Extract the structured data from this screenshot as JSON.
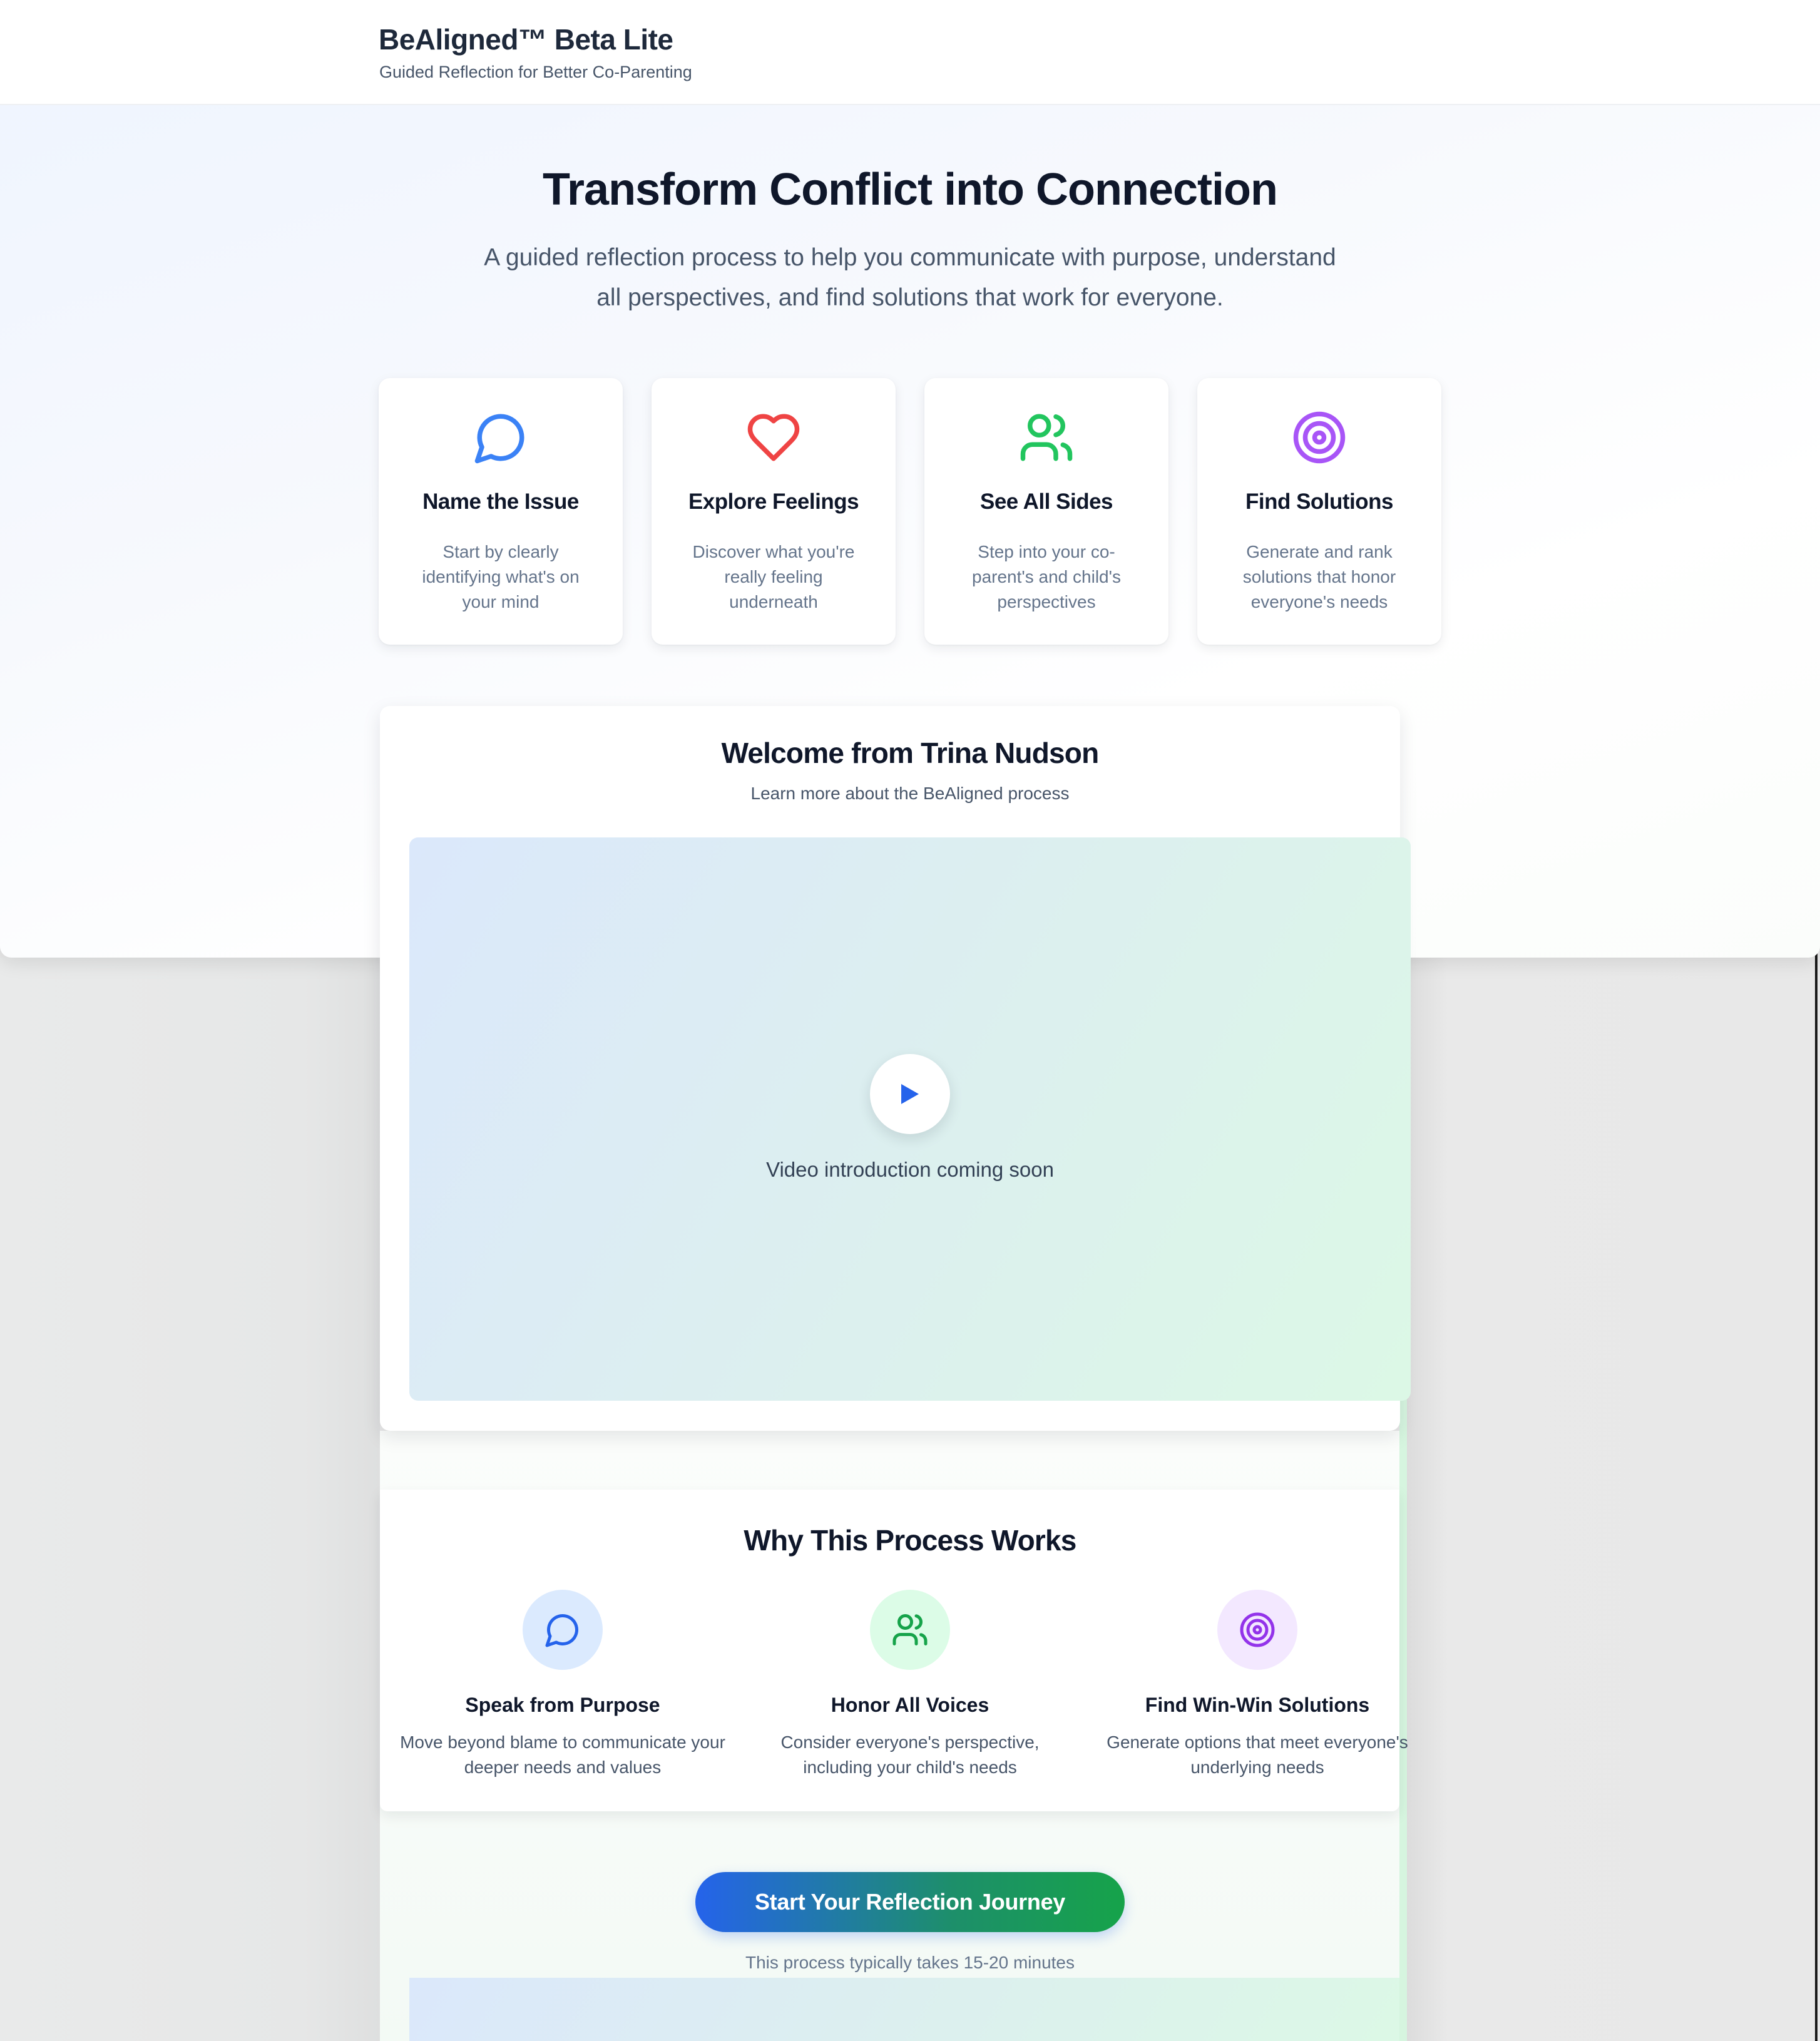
{
  "header": {
    "brand_title": "BeAligned™ Beta Lite",
    "brand_subtitle": "Guided Reflection for Better Co-Parenting"
  },
  "hero": {
    "title": "Transform Conflict into Connection",
    "subtitle": "A guided reflection process to help you communicate with purpose, understand all perspectives, and find solutions that work for everyone."
  },
  "steps": [
    {
      "icon": "chat-bubble-icon",
      "color": "#3b82f6",
      "title": "Name the Issue",
      "description": "Start by clearly identifying what's on your mind"
    },
    {
      "icon": "heart-icon",
      "color": "#ef4444",
      "title": "Explore Feelings",
      "description": "Discover what you're really feeling underneath"
    },
    {
      "icon": "users-icon",
      "color": "#22c55e",
      "title": "See All Sides",
      "description": "Step into your co-parent's and child's perspectives"
    },
    {
      "icon": "target-icon",
      "color": "#a855f7",
      "title": "Find Solutions",
      "description": "Generate and rank solutions that honor everyone's needs"
    }
  ],
  "welcome": {
    "title": "Welcome from Trina Nudson",
    "subtitle": "Learn more about the BeAligned process",
    "video_caption": "Video introduction coming soon"
  },
  "why": {
    "title": "Why This Process Works",
    "items": [
      {
        "icon": "chat-bubble-icon",
        "color": "#2563eb",
        "bg": "#dbeafe",
        "title": "Speak from Purpose",
        "description": "Move beyond blame to communicate your deeper needs and values"
      },
      {
        "icon": "users-icon",
        "color": "#16a34a",
        "bg": "#dcfce7",
        "title": "Honor All Voices",
        "description": "Consider everyone's perspective, including your child's needs"
      },
      {
        "icon": "target-icon",
        "color": "#9333ea",
        "bg": "#f3e8ff",
        "title": "Find Win-Win Solutions",
        "description": "Generate options that meet everyone's underlying needs"
      }
    ]
  },
  "cta": {
    "button_label": "Start Your Reflection Journey",
    "note": "This process typically takes 15-20 minutes"
  }
}
